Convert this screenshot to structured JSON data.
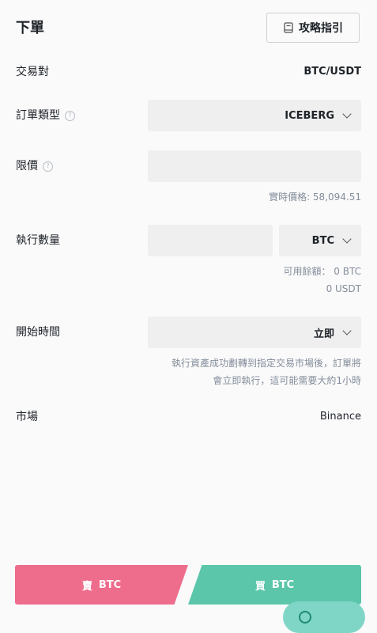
{
  "header": {
    "title": "下單",
    "guide_label": "攻略指引",
    "guide_icon": "book-icon"
  },
  "pair": {
    "label": "交易對",
    "value": "BTC/USDT"
  },
  "order_type": {
    "label": "訂單類型",
    "value": "ICEBERG"
  },
  "limit_price": {
    "label": "限價",
    "value": "",
    "realtime_price": "實時價格: 58,094.51"
  },
  "quantity": {
    "label": "執行數量",
    "value": "",
    "unit": "BTC",
    "available_line1": "可用餘額： 0 BTC",
    "available_line2": "0 USDT"
  },
  "start_time": {
    "label": "開始時間",
    "value": "立即",
    "note_line1": "執行資產成功劃轉到指定交易市場後，訂單將",
    "note_line2": "會立即執行，這可能需要大約1小時"
  },
  "market": {
    "label": "市場",
    "value": "Binance"
  },
  "actions": {
    "sell_prefix": "賣",
    "sell_asset": "BTC",
    "buy_prefix": "買",
    "buy_asset": "BTC"
  },
  "colors": {
    "sell": "#ee6c8c",
    "buy": "#5cc6aa",
    "bubble": "#7fd6c7"
  }
}
